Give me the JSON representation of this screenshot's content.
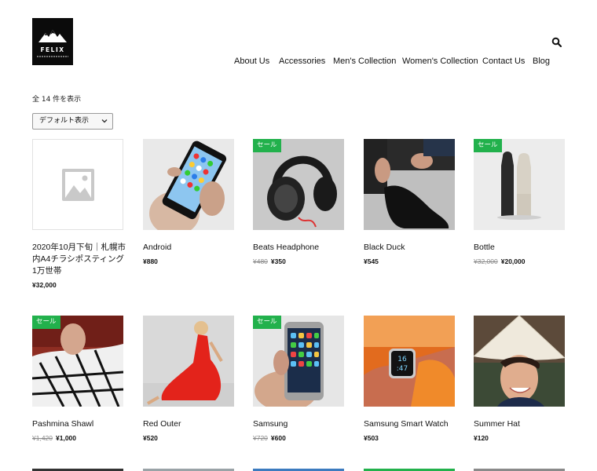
{
  "site": {
    "logo_text": "FELIX",
    "logo_alt": "FELIX logo"
  },
  "nav": [
    {
      "label": "About Us"
    },
    {
      "label": "Accessories"
    },
    {
      "label": "Men's Collection"
    },
    {
      "label": "Women's Collection"
    },
    {
      "label": "Contact Us"
    },
    {
      "label": "Blog"
    }
  ],
  "shop": {
    "result_count": "全 14 件を表示",
    "sort_selected": "デフォルト表示"
  },
  "sale_label": "セール",
  "products": [
    {
      "name": "2020年10月下旬｜札幌市内A4チラシポスティング1万世帯",
      "price": "¥32,000",
      "old_price": "",
      "sale": false
    },
    {
      "name": "Android",
      "price": "¥880",
      "old_price": "",
      "sale": false
    },
    {
      "name": "Beats Headphone",
      "price": "¥350",
      "old_price": "¥480",
      "sale": true
    },
    {
      "name": "Black Duck",
      "price": "¥545",
      "old_price": "",
      "sale": false
    },
    {
      "name": "Bottle",
      "price": "¥20,000",
      "old_price": "¥32,000",
      "sale": true
    },
    {
      "name": "Pashmina Shawl",
      "price": "¥1,000",
      "old_price": "¥1,420",
      "sale": true
    },
    {
      "name": "Red Outer",
      "price": "¥520",
      "old_price": "",
      "sale": false
    },
    {
      "name": "Samsung",
      "price": "¥600",
      "old_price": "¥720",
      "sale": true
    },
    {
      "name": "Samsung Smart Watch",
      "price": "¥503",
      "old_price": "",
      "sale": false
    },
    {
      "name": "Summer Hat",
      "price": "¥120",
      "old_price": "",
      "sale": false
    }
  ],
  "watch_face": "16:47",
  "colors": {
    "sale_badge": "#22b14c",
    "logo_bg": "#0b0b0b"
  }
}
